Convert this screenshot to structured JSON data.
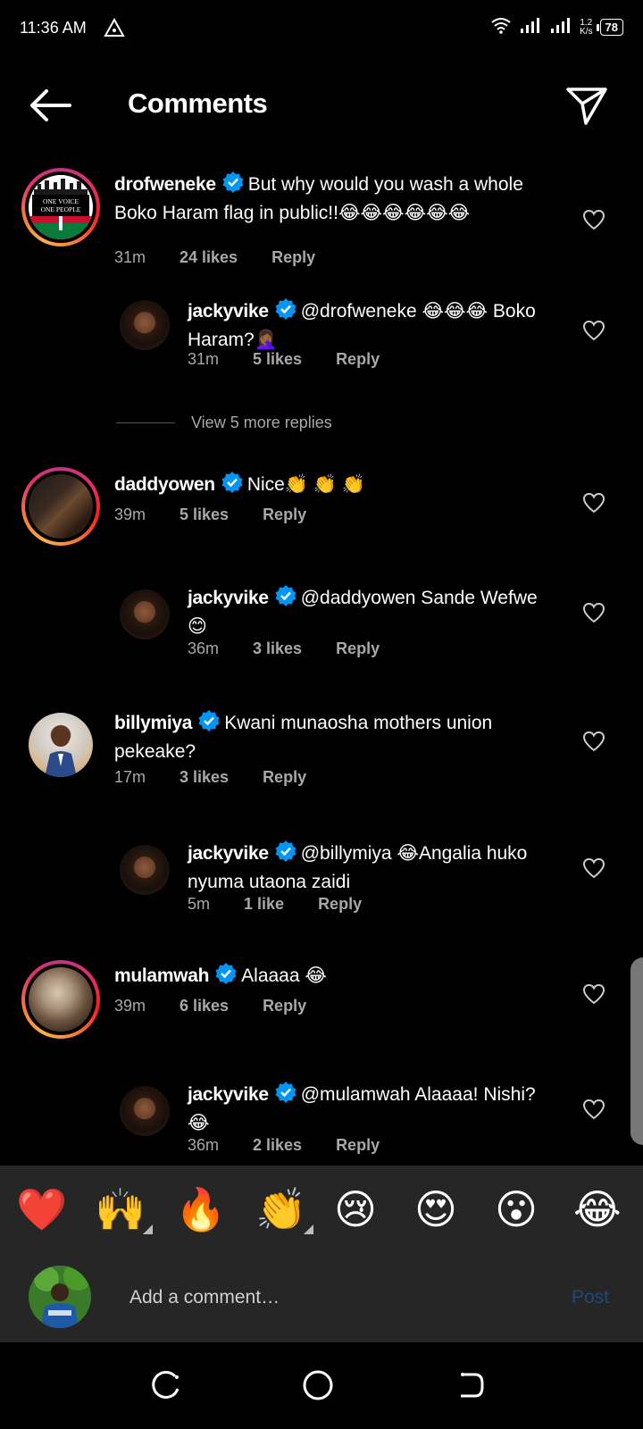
{
  "status_bar": {
    "time": "11:36 AM",
    "speed_top": "1.2",
    "speed_bottom": "K/s",
    "battery": "78"
  },
  "header": {
    "title": "Comments"
  },
  "comments": [
    {
      "user": "drofweneke",
      "text": "But why would you wash a whole Boko Haram flag in public!!😂😂😂😂😂😂",
      "time": "31m",
      "likes": "24 likes",
      "reply": "Reply"
    },
    {
      "user": "jackyvike",
      "text": "@drofweneke 😂😂😂 Boko Haram?🤦🏾‍♀️",
      "time": "31m",
      "likes": "5 likes",
      "reply": "Reply"
    },
    {
      "user": "daddyowen",
      "text": "Nice👏 👏 👏",
      "time": "39m",
      "likes": "5 likes",
      "reply": "Reply"
    },
    {
      "user": "jackyvike",
      "text": "@daddyowen Sande Wefwe😊",
      "time": "36m",
      "likes": "3 likes",
      "reply": "Reply"
    },
    {
      "user": "billymiya",
      "text": "Kwani munaosha mothers union pekeake?",
      "time": "17m",
      "likes": "3 likes",
      "reply": "Reply"
    },
    {
      "user": "jackyvike",
      "text": "@billymiya 😂Angalia huko nyuma utaona zaidi",
      "time": "5m",
      "likes": "1 like",
      "reply": "Reply"
    },
    {
      "user": "mulamwah",
      "text": "Alaaaa 😂",
      "time": "39m",
      "likes": "6 likes",
      "reply": "Reply"
    },
    {
      "user": "jackyvike",
      "text": "@mulamwah Alaaaa! Nishi?😂",
      "time": "36m",
      "likes": "2 likes",
      "reply": "Reply"
    }
  ],
  "view_more": "View 5 more replies",
  "avatar_text": {
    "drofweneke_line1": "ONE VOICE",
    "drofweneke_line2": "ONE PEOPLE"
  },
  "reaction_emojis": [
    "❤️",
    "🙌",
    "🔥",
    "👏",
    "😢",
    "😍",
    "😮",
    "😂"
  ],
  "comment_box": {
    "placeholder": "Add a comment…",
    "post_label": "Post"
  },
  "colors": {
    "background": "#000000",
    "verified": "#0095f6",
    "post_disabled": "#1e4a74",
    "meta_gray": "#a8a8a8"
  }
}
